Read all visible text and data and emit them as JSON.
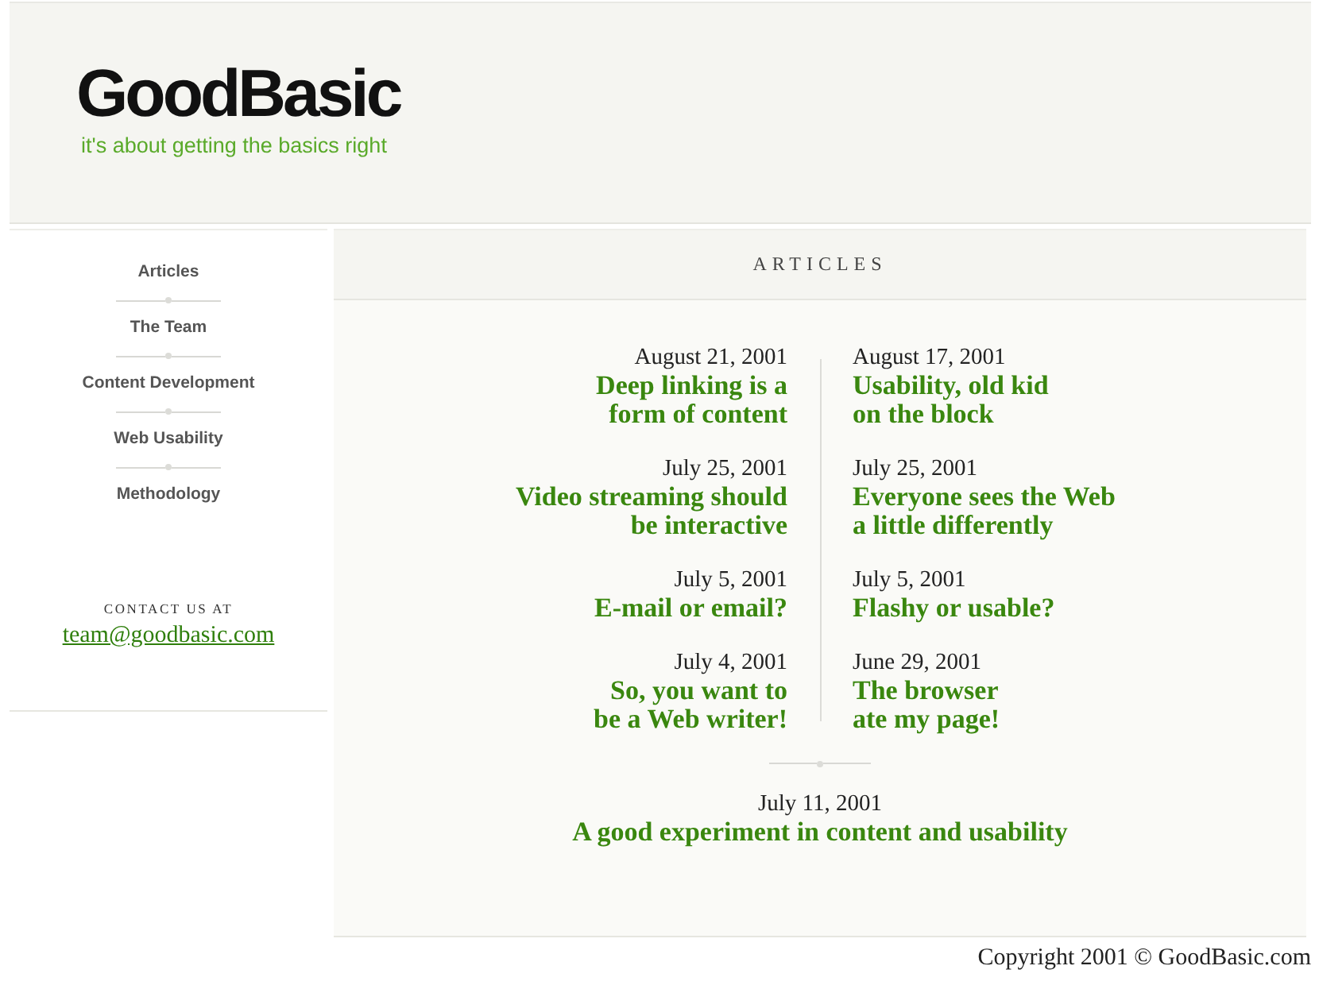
{
  "header": {
    "logo": "GoodBasic",
    "tagline": "it's about getting the basics right"
  },
  "sidebar": {
    "nav": [
      "Articles",
      "The Team",
      "Content Development",
      "Web Usability",
      "Methodology"
    ],
    "contact": {
      "label": "CONTACT US AT",
      "email": "team@goodbasic.com"
    }
  },
  "content": {
    "heading": "ARTICLES",
    "rows": [
      {
        "left": {
          "date": "August 21, 2001",
          "title_lines": [
            "Deep linking is a",
            "form of content"
          ]
        },
        "right": {
          "date": "August 17, 2001",
          "title_lines": [
            "Usability, old kid",
            "on the block"
          ]
        }
      },
      {
        "left": {
          "date": "July 25, 2001",
          "title_lines": [
            "Video streaming should",
            "be interactive"
          ]
        },
        "right": {
          "date": "July 25, 2001",
          "title_lines": [
            "Everyone sees the Web",
            "a little differently"
          ]
        }
      },
      {
        "left": {
          "date": "July 5, 2001",
          "title_lines": [
            "E-mail or email?"
          ]
        },
        "right": {
          "date": "July 5, 2001",
          "title_lines": [
            "Flashy or usable?"
          ]
        }
      },
      {
        "left": {
          "date": "July 4, 2001",
          "title_lines": [
            "So, you want to",
            "be a Web writer!"
          ]
        },
        "right": {
          "date": "June 29, 2001",
          "title_lines": [
            "The browser",
            "ate my page!"
          ]
        }
      }
    ],
    "featured": {
      "date": "July 11, 2001",
      "title": "A good experiment in content and usability"
    }
  },
  "footer": {
    "copyright": "Copyright 2001 © GoodBasic.com"
  }
}
